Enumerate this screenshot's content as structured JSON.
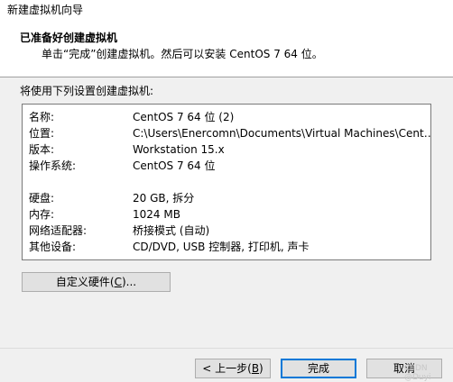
{
  "window": {
    "title": "新建虚拟机向导"
  },
  "header": {
    "title": "已准备好创建虚拟机",
    "subtitle": "单击“完成”创建虚拟机。然后可以安装 CentOS 7 64 位。"
  },
  "intro": "将使用下列设置创建虚拟机:",
  "summary": [
    {
      "label": "名称:",
      "value": "CentOS 7 64 位 (2)"
    },
    {
      "label": "位置:",
      "value": "C:\\Users\\Enercomn\\Documents\\Virtual Machines\\CentOS ..."
    },
    {
      "label": "版本:",
      "value": "Workstation 15.x"
    },
    {
      "label": "操作系统:",
      "value": "CentOS 7 64 位"
    },
    {
      "label": "硬盘:",
      "value": "20 GB, 拆分"
    },
    {
      "label": "内存:",
      "value": "1024 MB"
    },
    {
      "label": "网络适配器:",
      "value": "桥接模式 (自动)"
    },
    {
      "label": "其他设备:",
      "value": "CD/DVD, USB 控制器, 打印机, 声卡"
    }
  ],
  "buttons": {
    "customize": {
      "pre": "自定义硬件(",
      "key": "C",
      "post": ")..."
    },
    "back": {
      "pre": "< 上一步(",
      "key": "B",
      "post": ")"
    },
    "finish": "完成",
    "cancel": "取消"
  },
  "watermark": "CSDN @Duyi"
}
